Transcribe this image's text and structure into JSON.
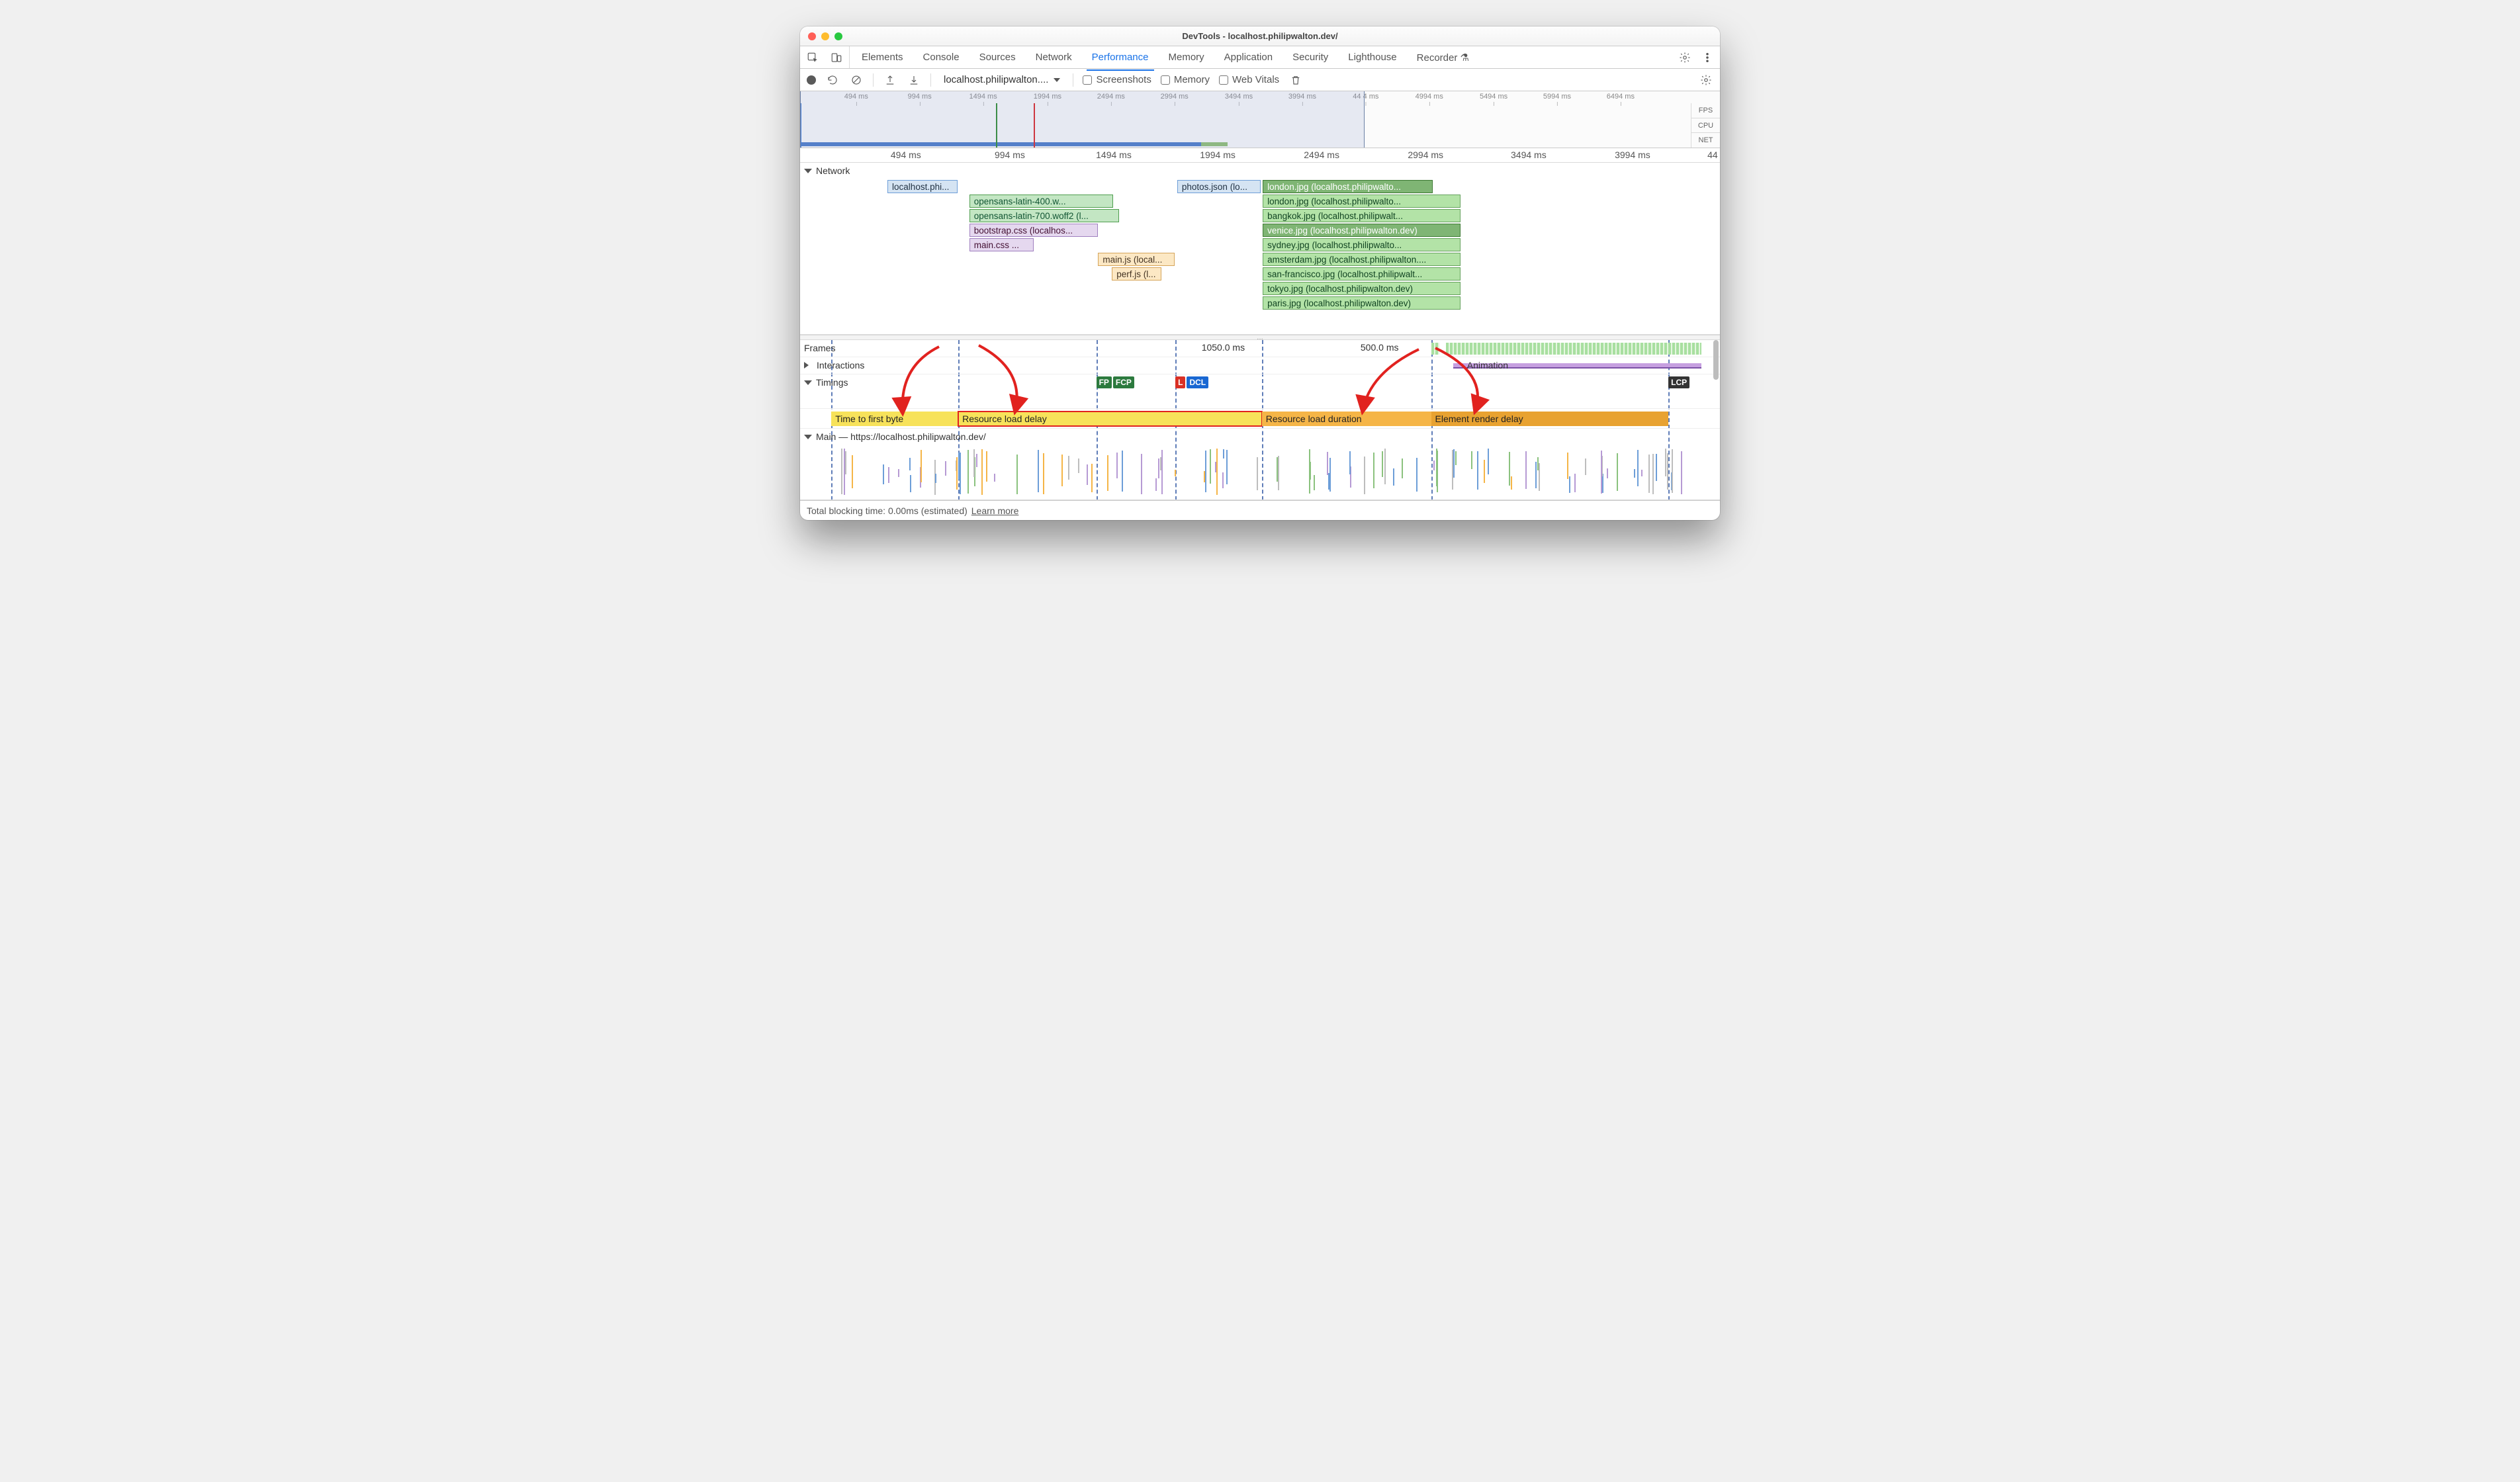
{
  "window": {
    "title": "DevTools - localhost.philipwalton.dev/"
  },
  "tabs": {
    "items": [
      "Elements",
      "Console",
      "Sources",
      "Network",
      "Performance",
      "Memory",
      "Application",
      "Security",
      "Lighthouse",
      "Recorder ⚗"
    ],
    "active": 4
  },
  "toolbar": {
    "profile_label": "localhost.philipwalton....",
    "screenshots": "Screenshots",
    "memory": "Memory",
    "webvitals": "Web Vitals"
  },
  "overview": {
    "ticks": [
      {
        "pct": 6.1,
        "label": "494 ms"
      },
      {
        "pct": 13.0,
        "label": "994 ms"
      },
      {
        "pct": 19.9,
        "label": "1494 ms"
      },
      {
        "pct": 26.9,
        "label": "1994 ms"
      },
      {
        "pct": 33.8,
        "label": "2494 ms"
      },
      {
        "pct": 40.7,
        "label": "2994 ms"
      },
      {
        "pct": 47.7,
        "label": "3494 ms"
      },
      {
        "pct": 54.6,
        "label": "3994 ms"
      },
      {
        "pct": 61.5,
        "label": "44  4 ms"
      },
      {
        "pct": 68.4,
        "label": "4994 ms"
      },
      {
        "pct": 75.4,
        "label": "5494 ms"
      },
      {
        "pct": 82.3,
        "label": "5994 ms"
      },
      {
        "pct": 89.2,
        "label": "6494 ms"
      }
    ],
    "side": {
      "fps": "FPS",
      "cpu": "CPU",
      "net": "NET"
    },
    "sel_left_pct": 0,
    "sel_right_pct": 61.4,
    "green_vline_pct": 22.0,
    "red_vline_pct": 26.2,
    "blue_vline_pct": 6.8
  },
  "main_ruler": {
    "ticks": [
      {
        "pct": 11.5,
        "label": "494 ms"
      },
      {
        "pct": 22.8,
        "label": "994 ms"
      },
      {
        "pct": 34.1,
        "label": "1494 ms"
      },
      {
        "pct": 45.4,
        "label": "1994 ms"
      },
      {
        "pct": 56.7,
        "label": "2494 ms"
      },
      {
        "pct": 68.0,
        "label": "2994 ms"
      },
      {
        "pct": 79.2,
        "label": "3494 ms"
      },
      {
        "pct": 90.5,
        "label": "3994 ms"
      },
      {
        "pct": 99.2,
        "label": "44"
      }
    ]
  },
  "network_track": {
    "label": "Network",
    "items": [
      {
        "lane": 0,
        "left": 9.5,
        "width": 7.6,
        "cls": "c-doc",
        "label": "localhost.phi..."
      },
      {
        "lane": 1,
        "left": 18.4,
        "width": 15.6,
        "cls": "c-font",
        "label": "opensans-latin-400.w..."
      },
      {
        "lane": 2,
        "left": 18.4,
        "width": 16.3,
        "cls": "c-font",
        "label": "opensans-latin-700.woff2 (l..."
      },
      {
        "lane": 3,
        "left": 18.4,
        "width": 14.0,
        "cls": "c-css",
        "label": "bootstrap.css (localhos..."
      },
      {
        "lane": 4,
        "left": 18.4,
        "width": 7.0,
        "cls": "c-css",
        "label": "main.css ..."
      },
      {
        "lane": 5,
        "left": 32.4,
        "width": 8.3,
        "cls": "c-js",
        "label": "main.js (local..."
      },
      {
        "lane": 6,
        "left": 33.9,
        "width": 5.4,
        "cls": "c-js",
        "label": "perf.js (l..."
      },
      {
        "lane": 0,
        "left": 41.0,
        "width": 9.1,
        "cls": "c-doc",
        "label": "photos.json (lo..."
      },
      {
        "lane": 0,
        "left": 50.3,
        "width": 18.5,
        "cls": "c-imgdark",
        "label": "london.jpg (localhost.philipwalto..."
      },
      {
        "lane": 1,
        "left": 50.3,
        "width": 21.5,
        "cls": "c-img",
        "label": "london.jpg (localhost.philipwalto..."
      },
      {
        "lane": 2,
        "left": 50.3,
        "width": 21.5,
        "cls": "c-img",
        "label": "bangkok.jpg (localhost.philipwalt..."
      },
      {
        "lane": 3,
        "left": 50.3,
        "width": 21.5,
        "cls": "c-imgdark",
        "label": "venice.jpg (localhost.philipwalton.dev)"
      },
      {
        "lane": 4,
        "left": 50.3,
        "width": 21.5,
        "cls": "c-img",
        "label": "sydney.jpg (localhost.philipwalto..."
      },
      {
        "lane": 5,
        "left": 50.3,
        "width": 21.5,
        "cls": "c-img",
        "label": "amsterdam.jpg (localhost.philipwalton...."
      },
      {
        "lane": 6,
        "left": 50.3,
        "width": 21.5,
        "cls": "c-img",
        "label": "san-francisco.jpg (localhost.philipwalt..."
      },
      {
        "lane": 7,
        "left": 50.3,
        "width": 21.5,
        "cls": "c-img",
        "label": "tokyo.jpg (localhost.philipwalton.dev)"
      },
      {
        "lane": 8,
        "left": 50.3,
        "width": 21.5,
        "cls": "c-img",
        "label": "paris.jpg (localhost.philipwalton.dev)"
      }
    ]
  },
  "frames_row": {
    "label": "Frames",
    "frame1_pct": 46.0,
    "frame1_label": "1050.0 ms",
    "frame2_pct": 63.0,
    "frame2_label": "500.0 ms",
    "anim_left": 71.0,
    "anim_width": 27.0,
    "anim_label": "Animation",
    "green_left": 68.6,
    "green_width": 0.9,
    "green2_left": 70.2,
    "green2_width": 27.8
  },
  "interactions": {
    "label": "Interactions"
  },
  "timings": {
    "label": "Timings",
    "fp_left": 32.2,
    "fp": "FP",
    "fcp": "FCP",
    "dcl_left": 40.8,
    "l": "L",
    "dcl": "DCL",
    "lcp_left": 94.4,
    "lcp": "LCP"
  },
  "segments": {
    "ttfb": {
      "left": 3.4,
      "width": 13.8,
      "label": "Time to first byte"
    },
    "rld": {
      "left": 17.2,
      "width": 33.0,
      "label": "Resource load delay"
    },
    "rldur": {
      "left": 50.2,
      "width": 18.4,
      "label": "Resource load duration"
    },
    "erd": {
      "left": 68.6,
      "width": 25.8,
      "label": "Element render delay"
    }
  },
  "vdash": [
    3.4,
    17.2,
    32.2,
    40.8,
    50.2,
    68.6,
    94.4
  ],
  "main_thread": {
    "label": "Main — https://localhost.philipwalton.dev/"
  },
  "footer": {
    "tbt": "Total blocking time: 0.00ms (estimated)",
    "learn": "Learn more"
  }
}
